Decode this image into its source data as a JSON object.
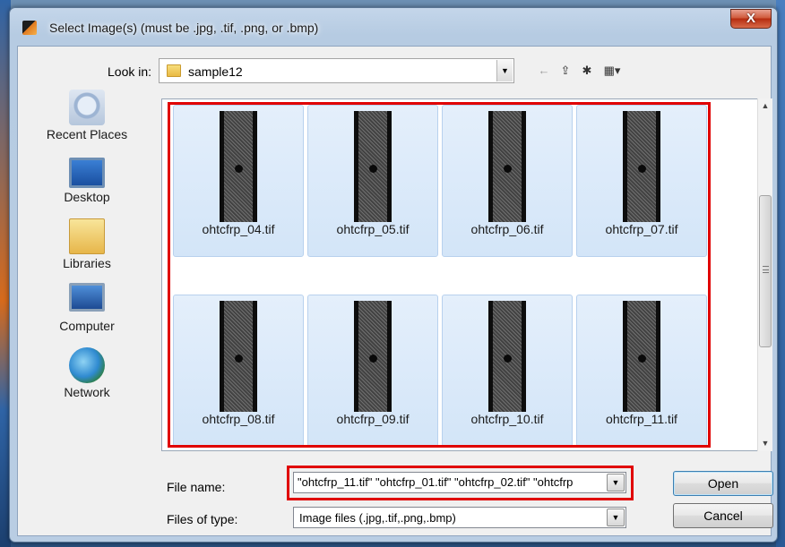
{
  "window": {
    "title": "Select Image(s) (must be .jpg, .tif, .png, or .bmp)",
    "close_label": "X"
  },
  "lookin": {
    "label": "Look in:",
    "value": "sample12"
  },
  "toolbar": {
    "back_icon": "←",
    "up_icon": "⇪",
    "newfolder_icon": "✱",
    "views_icon": "▦▾"
  },
  "places": [
    {
      "label": "Recent Places",
      "icon": "recent-places-icon"
    },
    {
      "label": "Desktop",
      "icon": "desktop-icon"
    },
    {
      "label": "Libraries",
      "icon": "libraries-icon"
    },
    {
      "label": "Computer",
      "icon": "computer-icon"
    },
    {
      "label": "Network",
      "icon": "network-icon"
    }
  ],
  "files": [
    {
      "name": "ohtcfrp_04.tif"
    },
    {
      "name": "ohtcfrp_05.tif"
    },
    {
      "name": "ohtcfrp_06.tif"
    },
    {
      "name": "ohtcfrp_07.tif"
    },
    {
      "name": "ohtcfrp_08.tif"
    },
    {
      "name": "ohtcfrp_09.tif"
    },
    {
      "name": "ohtcfrp_10.tif"
    },
    {
      "name": "ohtcfrp_11.tif"
    }
  ],
  "filename": {
    "label": "File name:",
    "value": "\"ohtcfrp_11.tif\" \"ohtcfrp_01.tif\" \"ohtcfrp_02.tif\" \"ohtcfrp"
  },
  "filetype": {
    "label": "Files of type:",
    "value": "Image files (.jpg,.tif,.png,.bmp)"
  },
  "buttons": {
    "open": "Open",
    "cancel": "Cancel"
  }
}
